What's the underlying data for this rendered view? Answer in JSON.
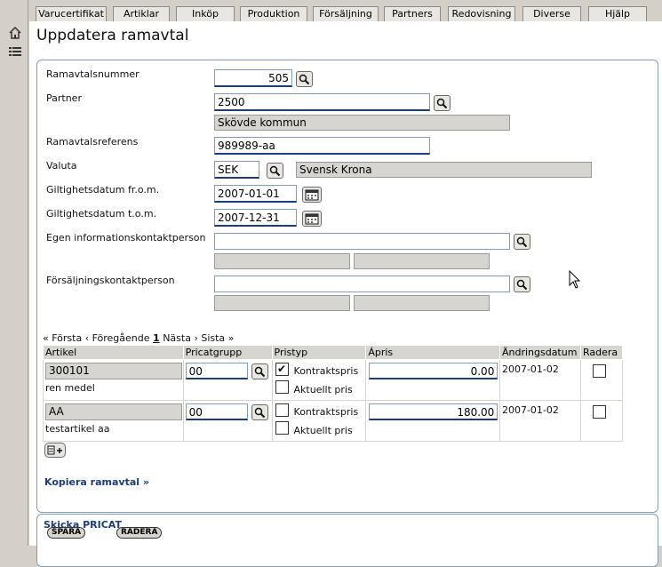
{
  "nav": {
    "tabs": [
      "Varucertifikat",
      "Artiklar",
      "Inköp",
      "Produktion",
      "Försäljning",
      "Partners",
      "Redovisning",
      "Diverse",
      "Hjälp"
    ]
  },
  "page": {
    "title": "Uppdatera ramavtal"
  },
  "form": {
    "ramavtalsnummer": {
      "label": "Ramavtalsnummer",
      "value": "505"
    },
    "partner": {
      "label": "Partner",
      "value": "2500",
      "name": "Skövde kommun"
    },
    "referens": {
      "label": "Ramavtalsreferens",
      "value": "989989-aa"
    },
    "valuta": {
      "label": "Valuta",
      "value": "SEK",
      "name": "Svensk Krona"
    },
    "from": {
      "label": "Giltighetsdatum fr.o.m.",
      "value": "2007-01-01"
    },
    "tom": {
      "label": "Giltighetsdatum t.o.m.",
      "value": "2007-12-31"
    },
    "egen": {
      "label": "Egen informationskontaktperson",
      "value": "",
      "a": "",
      "b": ""
    },
    "forsaljning": {
      "label": "Försäljningskontaktperson",
      "value": "",
      "a": "",
      "b": ""
    }
  },
  "pager": {
    "first": "« Första",
    "prev": "‹ Föregående",
    "page": "1",
    "next": "Nästa ›",
    "last": "Sista »"
  },
  "grid": {
    "headers": [
      "Artikel",
      "Pricatgrupp",
      "Pristyp",
      "Ápris",
      "Ändringsdatum",
      "Radera"
    ],
    "rows": [
      {
        "artikel": "300101",
        "artikel_name": "ren medel",
        "grupp": "00",
        "kontrakt_label": "Kontraktspris",
        "kontrakt": true,
        "aktuellt_label": "Aktuellt pris",
        "aktuellt": false,
        "apris": "0.00",
        "datum": "2007-01-02",
        "radera": false
      },
      {
        "artikel": "AA",
        "artikel_name": "testartikel aa",
        "grupp": "00",
        "kontrakt_label": "Kontraktspris",
        "kontrakt": false,
        "aktuellt_label": "Aktuellt pris",
        "aktuellt": false,
        "apris": "180.00",
        "datum": "2007-01-02",
        "radera": false
      }
    ]
  },
  "actions": {
    "kopiera": "Kopiera ramavtal »",
    "skicka": "Skicka PRICAT",
    "spara": "SPARA",
    "radera": "RADERA"
  }
}
